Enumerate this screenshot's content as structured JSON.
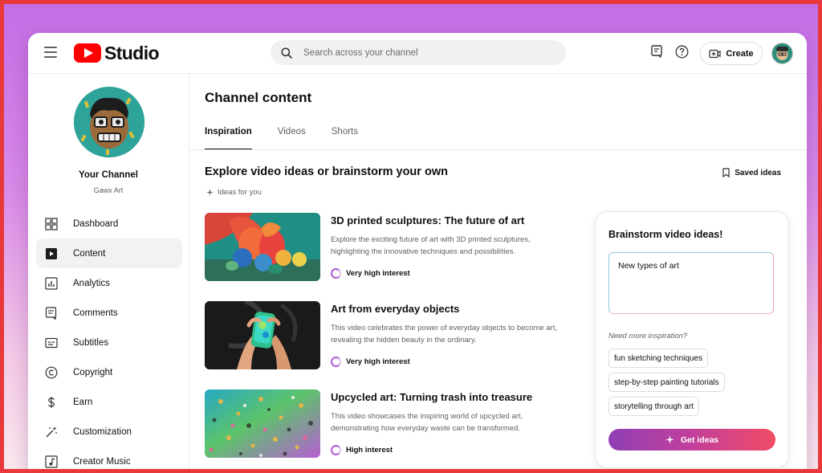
{
  "app": {
    "logo_text": "Studio",
    "brand_color": "#ff0000"
  },
  "header": {
    "search_placeholder": "Search across your channel",
    "create_label": "Create"
  },
  "channel": {
    "name": "Your Channel",
    "handle": "Gawx Art"
  },
  "sidebar": {
    "items": [
      {
        "label": "Dashboard",
        "icon": "dashboard-icon",
        "active": false
      },
      {
        "label": "Content",
        "icon": "content-icon",
        "active": true
      },
      {
        "label": "Analytics",
        "icon": "analytics-icon",
        "active": false
      },
      {
        "label": "Comments",
        "icon": "comments-icon",
        "active": false
      },
      {
        "label": "Subtitles",
        "icon": "subtitles-icon",
        "active": false
      },
      {
        "label": "Copyright",
        "icon": "copyright-icon",
        "active": false
      },
      {
        "label": "Earn",
        "icon": "dollar-icon",
        "active": false
      },
      {
        "label": "Customization",
        "icon": "magic-wand-icon",
        "active": false
      },
      {
        "label": "Creator Music",
        "icon": "music-icon",
        "active": false
      }
    ]
  },
  "main": {
    "title": "Channel content",
    "tabs": [
      {
        "label": "Inspiration",
        "active": true
      },
      {
        "label": "Videos",
        "active": false
      },
      {
        "label": "Shorts",
        "active": false
      }
    ],
    "section_title": "Explore video ideas or brainstorm your own",
    "ideas_for_you": "Ideas for you",
    "saved_ideas": "Saved ideas",
    "ideas": [
      {
        "title": "3D printed sculptures: The future of art",
        "description": "Explore the exciting future of art with 3D printed sculptures, highlighting the innovative techniques and possibilities.",
        "interest": "Very high interest"
      },
      {
        "title": "Art from everyday objects",
        "description": "This video celebrates the power of everyday objects to become art, revealing the hidden beauty in the ordinary.",
        "interest": "Very high interest"
      },
      {
        "title": "Upcycled art: Turning trash into treasure",
        "description": "This video showcases the inspiring world of upcycled art, demonstrating how everyday waste can be transformed.",
        "interest": "High interest"
      }
    ]
  },
  "brainstorm": {
    "title": "Brainstorm video ideas!",
    "input_value": "New types of art",
    "need_more": "Need more inspiration?",
    "suggestions": [
      "fun sketching techniques",
      "step-by-step painting tutorials",
      "storytelling through art"
    ],
    "button_label": "Get ideas"
  }
}
